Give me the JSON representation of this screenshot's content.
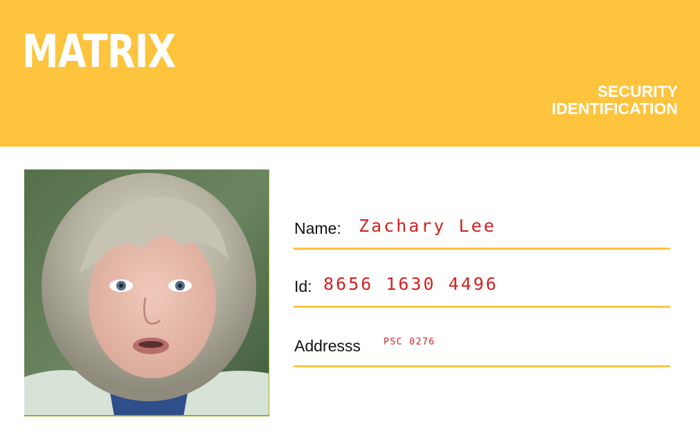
{
  "card": {
    "brand": "MATRIX",
    "document_type_line1": "SECURITY",
    "document_type_line2": "IDENTIFICATION",
    "colors": {
      "header": "#fec43e",
      "field_value": "#d42020",
      "divider": "#fec43e"
    }
  },
  "fields": {
    "name_label": "Name:",
    "name_value": "Zachary Lee",
    "id_label": "Id:",
    "id_value": "8656 1630 4496",
    "address_label": "Addresss",
    "address_value": "PSC 0276"
  }
}
